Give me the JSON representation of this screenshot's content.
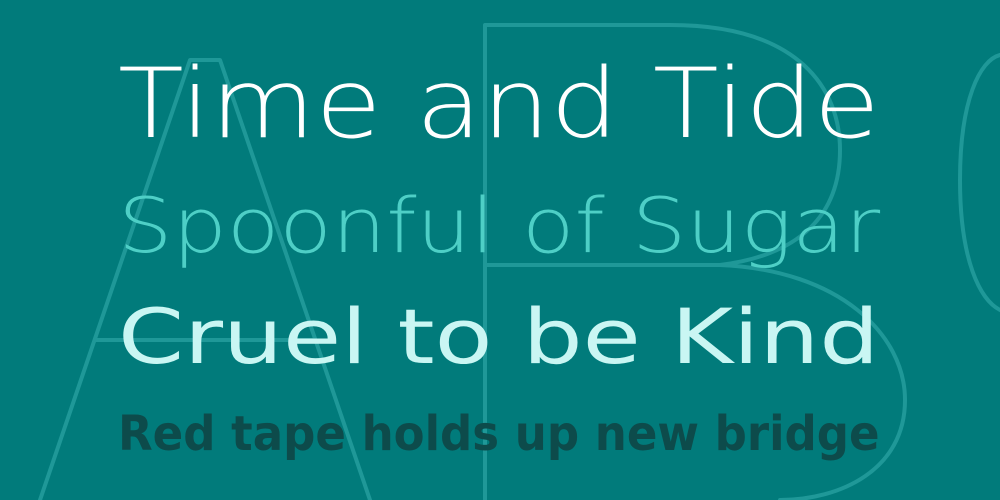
{
  "lines": {
    "line1": "Time and Tide",
    "line2": "Spoonful of Sugar",
    "line3": "Cruel to be Kind",
    "line4": "Red tape holds up new bridge"
  },
  "colors": {
    "background": "#017b7b",
    "line1": "#ffffff",
    "line2": "#4ecfc6",
    "line3": "#c9f6f3",
    "line4": "#0d4b4b",
    "outline_letters": "#1f9898"
  }
}
